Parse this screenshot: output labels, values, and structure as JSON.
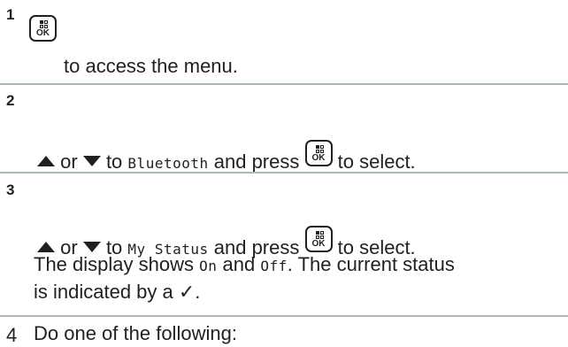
{
  "steps": [
    {
      "number": "1",
      "text": "to access the menu."
    },
    {
      "number": "2",
      "or": "or",
      "to": "to",
      "target": "Bluetooth",
      "and_press": "and press",
      "to_select": "to select."
    },
    {
      "number": "3",
      "or": "or",
      "to": "to",
      "target": "My Status",
      "and_press": "and press",
      "to_select": "to select.",
      "display_shows": "The display shows",
      "on": "On",
      "and": "and",
      "off": "Off",
      "current_status": ". The current status",
      "indicated_by": "is indicated by a ✓."
    },
    {
      "number": "4",
      "text": "Do one of the following:"
    }
  ],
  "ok_button": {
    "label": "OK"
  },
  "colors": {
    "text": "#231f20",
    "divider": "#aab8c0"
  }
}
